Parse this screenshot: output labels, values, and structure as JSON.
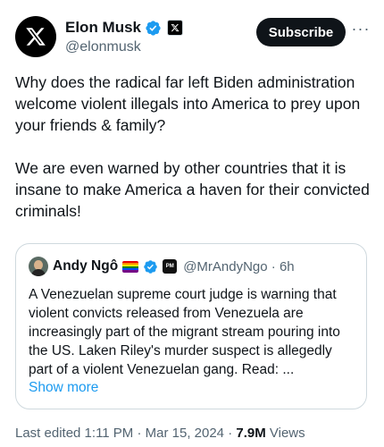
{
  "author": {
    "name": "Elon Musk",
    "handle": "@elonmusk",
    "avatar_icon": "x-logo-icon"
  },
  "actions": {
    "subscribe_label": "Subscribe",
    "more_label": "···"
  },
  "tweet": {
    "text": "Why does the radical far left Biden administration welcome violent illegals into America to prey upon your friends & family?\n\nWe are even warned by other countries that it is insane to make America a haven for their convicted criminals!"
  },
  "quote": {
    "name": "Andy Ngô",
    "handle_time": "@MrAndyNgo · 6h",
    "badge_text": "PM",
    "text": "A Venezuelan supreme court judge is warning that violent convicts released from Venezuela are increasingly part of the migrant stream pouring into the US. Laken Riley's murder suspect is allegedly part of a violent Venezuelan gang. Read:  ...",
    "show_more": "Show more",
    "flag_colors": [
      "#e40303",
      "#ff8c00",
      "#ffed00",
      "#008026",
      "#004dff",
      "#750787"
    ]
  },
  "meta": {
    "edited": "Last edited 1:11 PM · Mar 15, 2024 · ",
    "views_count": "7.9M",
    "views_label": " Views"
  },
  "colors": {
    "text": "#0f1419",
    "secondary": "#536471",
    "link": "#1d9bf0",
    "verified": "#1d9bf0"
  }
}
